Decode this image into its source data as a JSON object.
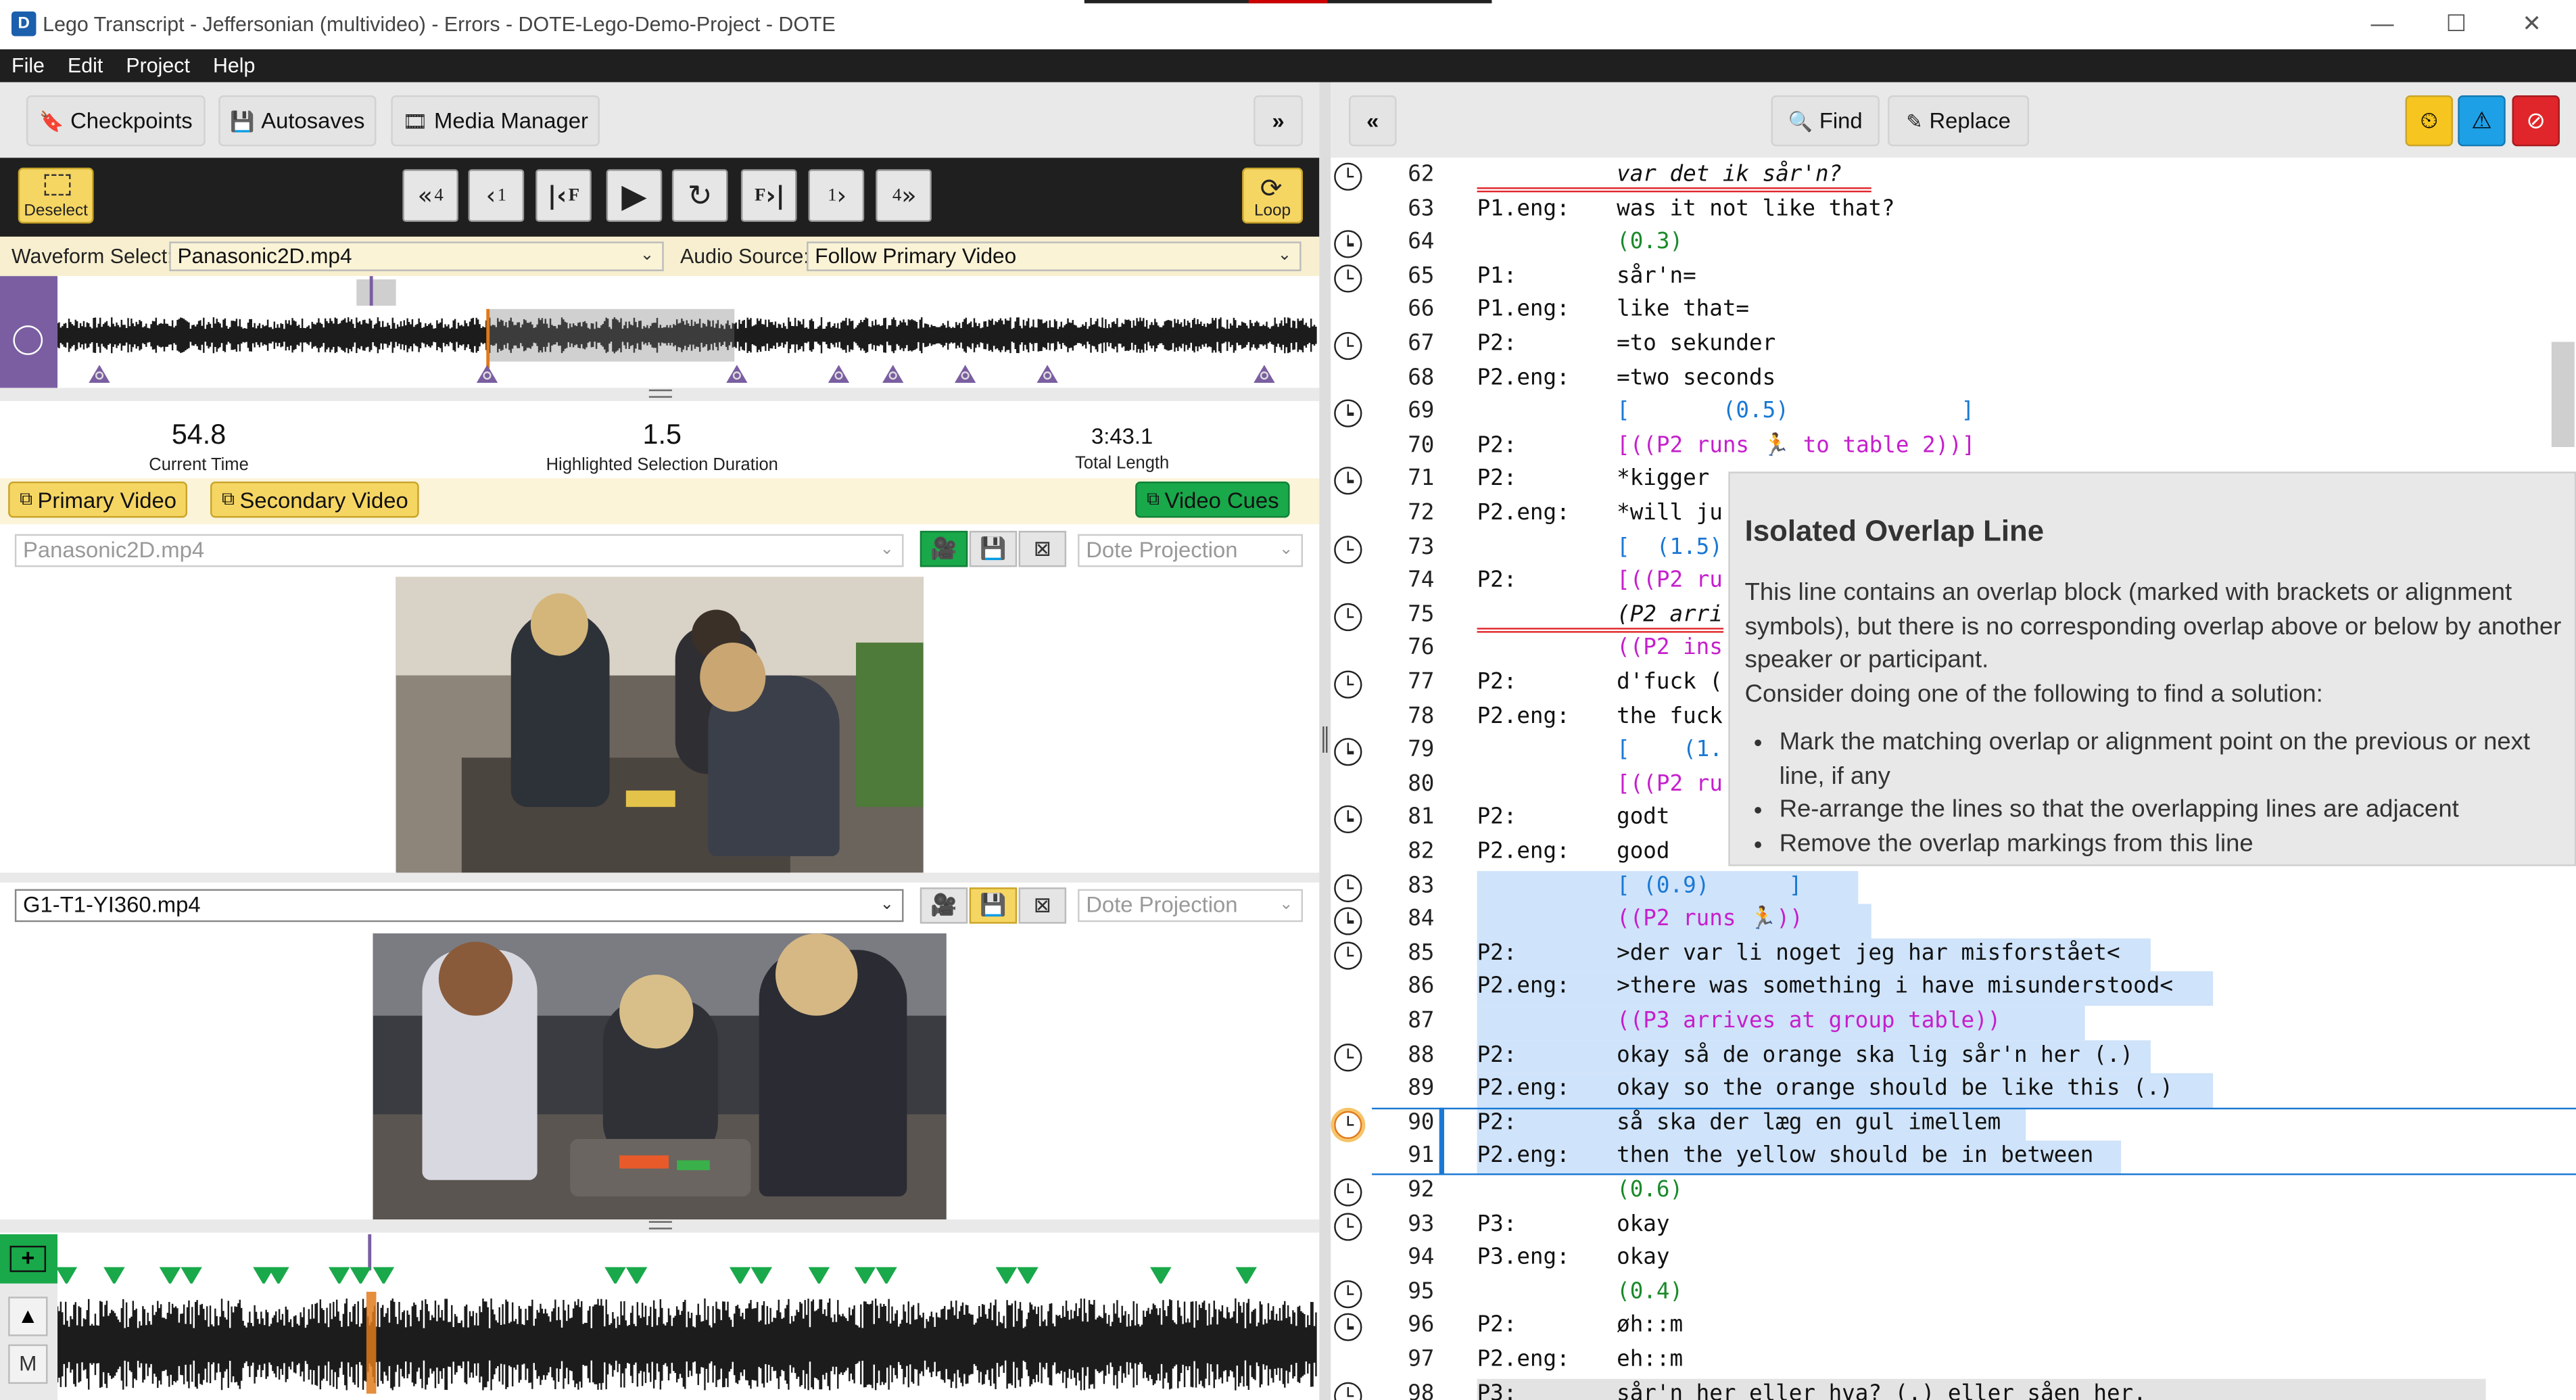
{
  "window": {
    "title": "Lego Transcript - Jeffersonian (multivideo) - Errors - DOTE-Lego-Demo-Project - DOTE",
    "app_icon": "D"
  },
  "menu": [
    "File",
    "Edit",
    "Project",
    "Help"
  ],
  "left_toolbar": {
    "checkpoints": "Checkpoints",
    "autosaves": "Autosaves",
    "media_manager": "Media Manager",
    "collapse": "»"
  },
  "playback": {
    "deselect": "Deselect",
    "loop": "Loop",
    "back4": "4",
    "back1": "1",
    "frame_back": "F",
    "frame_fwd": "F",
    "fwd1": "1",
    "fwd4": "4"
  },
  "waveform": {
    "select_label": "Waveform Select:",
    "select_value": "Panasonic2D.mp4",
    "audio_label": "Audio Source:",
    "audio_value": "Follow Primary Video"
  },
  "stats": {
    "current_time": "54.8",
    "current_time_label": "Current Time",
    "selection_duration": "1.5",
    "selection_label": "Highlighted Selection Duration",
    "total_length": "3:43.1",
    "total_label": "Total Length"
  },
  "video_tabs": {
    "primary": "Primary Video",
    "secondary": "Secondary Video",
    "cues": "Video Cues"
  },
  "primary_video": {
    "file": "Panasonic2D.mp4",
    "projection": "Dote Projection"
  },
  "secondary_video": {
    "file": "G1-T1-YI360.mp4",
    "projection": "Dote Projection"
  },
  "bottom_controls": {
    "m_label": "M"
  },
  "right_toolbar": {
    "collapse": "«",
    "find": "Find",
    "replace": "Replace"
  },
  "colors": {
    "accent_yellow": "#f6d663",
    "green": "#19a84a",
    "purple": "#7a5ea1",
    "info_blue": "#1ea0e6",
    "error_red": "#e0262b",
    "overlap_blue": "#1a78d4",
    "action_magenta": "#c51fcc",
    "pause_green": "#1a8a2a"
  },
  "transcript": [
    {
      "n": "62",
      "spk": "",
      "txt": "var det ik sår'n?",
      "style": "it",
      "clock": true
    },
    {
      "n": "63",
      "spk": "P1.eng:",
      "txt": "was it not like that?",
      "clock": false
    },
    {
      "n": "64",
      "spk": "",
      "txt": "(0.3)",
      "style": "g",
      "clock": true
    },
    {
      "n": "65",
      "spk": "P1:",
      "txt": "sår'n=",
      "clock": true
    },
    {
      "n": "66",
      "spk": "P1.eng:",
      "txt": "like that=",
      "clock": false
    },
    {
      "n": "67",
      "spk": "P2:",
      "txt": "=to sekunder",
      "clock": true
    },
    {
      "n": "68",
      "spk": "P2.eng:",
      "txt": "=two seconds",
      "clock": false
    },
    {
      "n": "69",
      "spk": "",
      "txt": "[       (0.5)             ]",
      "style": "bg",
      "clock": true
    },
    {
      "n": "70",
      "spk": "P2:",
      "txt": "[((P2 runs 🏃 to table 2))]",
      "style": "bm",
      "clock": false
    },
    {
      "n": "71",
      "spk": "P2:",
      "txt": "*kigger",
      "clock": true
    },
    {
      "n": "72",
      "spk": "P2.eng:",
      "txt": "*will ju",
      "clock": false
    },
    {
      "n": "73",
      "spk": "",
      "txt": "[  (1.5)",
      "style": "bg",
      "clock": true
    },
    {
      "n": "74",
      "spk": "P2:",
      "txt": "[((P2 ru",
      "style": "bm",
      "clock": false
    },
    {
      "n": "75",
      "spk": "",
      "txt": "(P2 arri",
      "style": "it",
      "clock": true
    },
    {
      "n": "76",
      "spk": "",
      "txt": "((P2 ins",
      "style": "m",
      "clock": false
    },
    {
      "n": "77",
      "spk": "P2:",
      "txt": "d'fuck (",
      "clock": true
    },
    {
      "n": "78",
      "spk": "P2.eng:",
      "txt": "the fuck",
      "clock": false
    },
    {
      "n": "79",
      "spk": "",
      "txt": "[    (1.",
      "style": "bg",
      "clock": true
    },
    {
      "n": "80",
      "spk": "",
      "txt": "[((P2 ru",
      "style": "bm",
      "clock": false
    },
    {
      "n": "81",
      "spk": "P2:",
      "txt": "godt",
      "clock": true
    },
    {
      "n": "82",
      "spk": "P2.eng:",
      "txt": "good",
      "clock": false
    },
    {
      "n": "83",
      "spk": "",
      "txt": "[ (0.9)      ]",
      "style": "bg",
      "clock": true
    },
    {
      "n": "84",
      "spk": "",
      "txt": "((P2 runs 🏃))",
      "style": "m",
      "clock": true
    },
    {
      "n": "85",
      "spk": "P2:",
      "txt": ">der var li noget jeg har misforstået<",
      "clock": true
    },
    {
      "n": "86",
      "spk": "P2.eng:",
      "txt": ">there was something i have misunderstood<",
      "clock": false
    },
    {
      "n": "87",
      "spk": "",
      "txt": "((P3 arrives at group table))",
      "style": "m",
      "clock": false
    },
    {
      "n": "88",
      "spk": "P2:",
      "txt": "okay så de orange ska lig sår'n her (.)",
      "clock": true
    },
    {
      "n": "89",
      "spk": "P2.eng:",
      "txt": "okay so the orange should be like this (.)",
      "clock": false
    },
    {
      "n": "90",
      "spk": "P2:",
      "txt": "så ska der læg en gul imellem",
      "clock": true
    },
    {
      "n": "91",
      "spk": "P2.eng:",
      "txt": "then the yellow should be in between",
      "clock": false
    },
    {
      "n": "92",
      "spk": "",
      "txt": "(0.6)",
      "style": "g",
      "clock": true
    },
    {
      "n": "93",
      "spk": "P3:",
      "txt": "okay",
      "clock": true
    },
    {
      "n": "94",
      "spk": "P3.eng:",
      "txt": "okay",
      "clock": false
    },
    {
      "n": "95",
      "spk": "",
      "txt": "(0.4)",
      "style": "g",
      "clock": true
    },
    {
      "n": "96",
      "spk": "P2:",
      "txt": "øh::m",
      "clock": true
    },
    {
      "n": "97",
      "spk": "P2.eng:",
      "txt": "eh::m",
      "clock": false
    },
    {
      "n": "98",
      "spk": "P3:",
      "txt": "sår'n her eller hva? (.) eller såen her.",
      "clock": true
    }
  ],
  "tooltip": {
    "title": "Isolated Overlap Line",
    "body": "This line contains an overlap block (marked with brackets or alignment symbols), but there is no corresponding overlap above or below by another speaker or participant.",
    "consider": "Consider doing one of the following to find a solution:",
    "items": [
      "Mark the matching overlap or alignment point on the previous or next line, if any",
      "Re-arrange the lines so that the overlapping lines are adjacent",
      "Remove the overlap markings from this line"
    ]
  }
}
